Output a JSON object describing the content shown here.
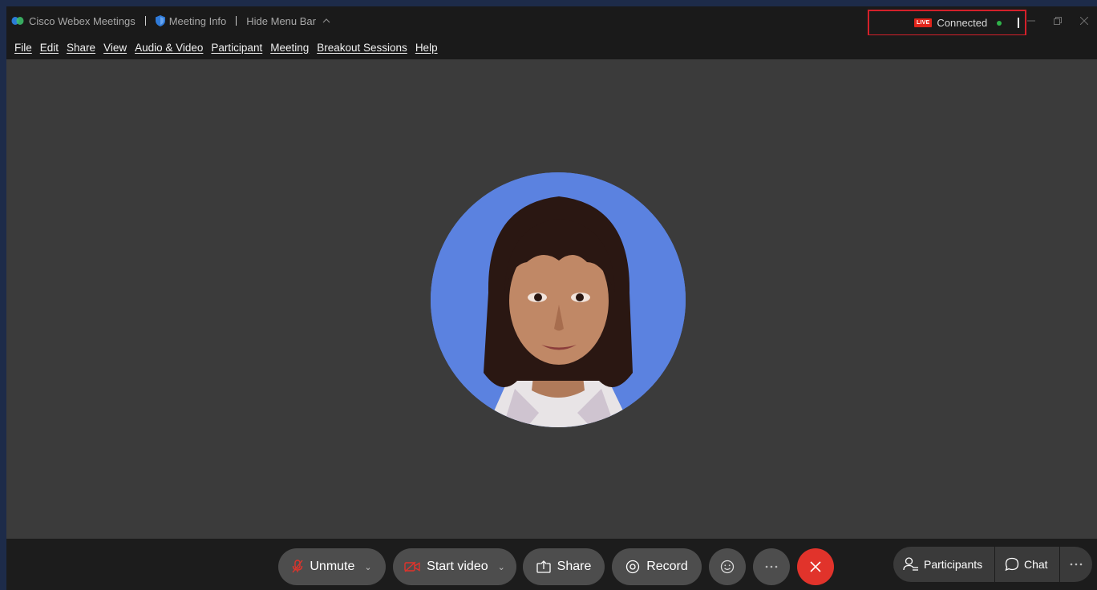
{
  "titlebar": {
    "app_name": "Cisco Webex Meetings",
    "meeting_info": "Meeting Info",
    "hide_menu_bar": "Hide Menu Bar",
    "live_badge": "LIVE",
    "status": "Connected"
  },
  "menu": {
    "items": [
      "File",
      "Edit",
      "Share",
      "View",
      "Audio & Video",
      "Participant",
      "Meeting",
      "Breakout Sessions",
      "Help"
    ]
  },
  "controls": {
    "unmute": "Unmute",
    "start_video": "Start video",
    "share": "Share",
    "record": "Record",
    "participants": "Participants",
    "chat": "Chat"
  },
  "colors": {
    "end_button": "#e1332b",
    "live_badge": "#e1251b",
    "connected_dot": "#2fb34a",
    "avatar_bg": "#5b82e0",
    "highlight_box": "#d4202a"
  },
  "icons": {
    "mute": "microphone-off-icon",
    "video": "video-off-icon",
    "share": "share-screen-icon",
    "record": "record-icon",
    "reactions": "smiley-icon",
    "more": "more-dots-icon",
    "end": "close-icon",
    "participants": "participants-icon",
    "chat": "chat-bubble-icon"
  }
}
